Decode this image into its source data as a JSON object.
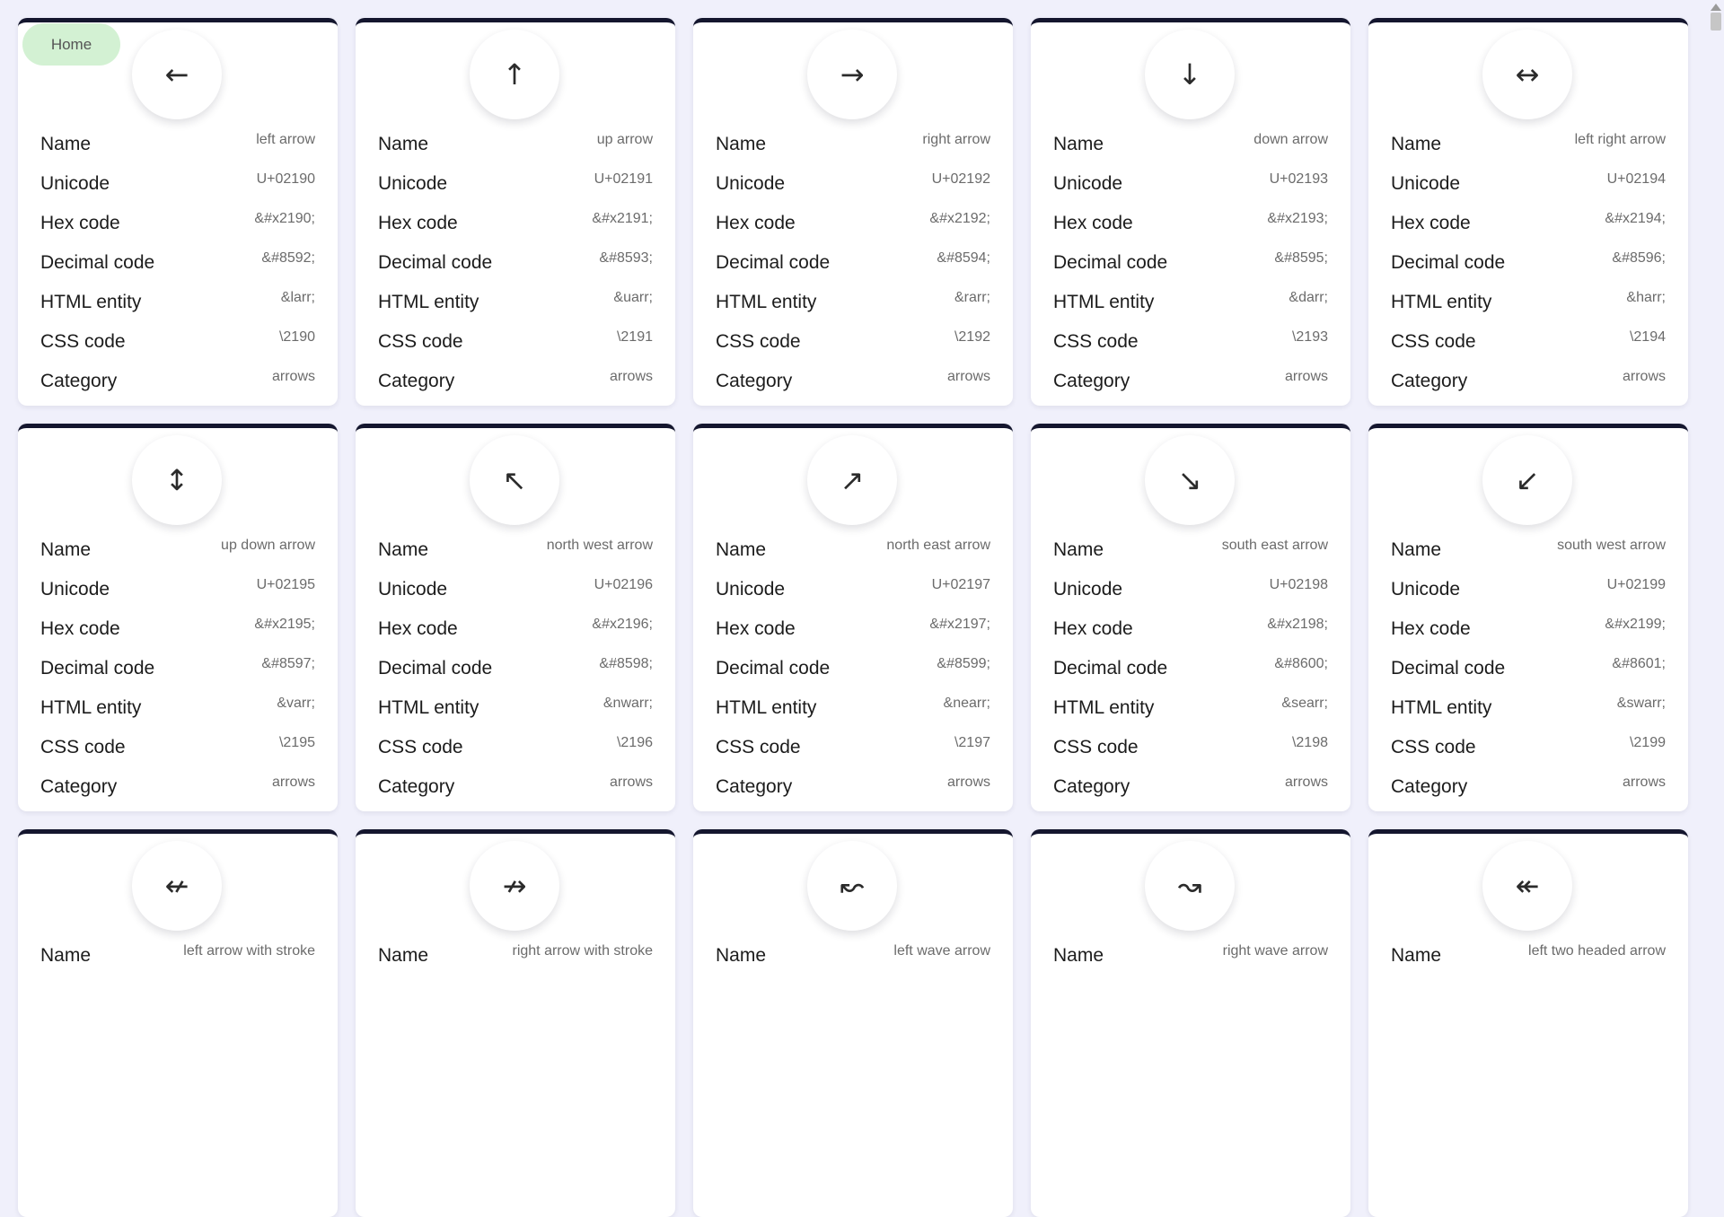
{
  "home_button": {
    "label": "Home"
  },
  "field_labels": {
    "name": "Name",
    "unicode": "Unicode",
    "hex": "Hex code",
    "decimal": "Decimal code",
    "entity": "HTML entity",
    "css": "CSS code",
    "category": "Category"
  },
  "cards": [
    {
      "glyph": "←",
      "icon": "left-arrow-icon",
      "name": "left arrow",
      "unicode": "U+02190",
      "hex": "&#x2190;",
      "decimal": "&#8592;",
      "entity": "&larr;",
      "css": "\\2190",
      "category": "arrows"
    },
    {
      "glyph": "↑",
      "icon": "up-arrow-icon",
      "name": "up arrow",
      "unicode": "U+02191",
      "hex": "&#x2191;",
      "decimal": "&#8593;",
      "entity": "&uarr;",
      "css": "\\2191",
      "category": "arrows"
    },
    {
      "glyph": "→",
      "icon": "right-arrow-icon",
      "name": "right arrow",
      "unicode": "U+02192",
      "hex": "&#x2192;",
      "decimal": "&#8594;",
      "entity": "&rarr;",
      "css": "\\2192",
      "category": "arrows"
    },
    {
      "glyph": "↓",
      "icon": "down-arrow-icon",
      "name": "down arrow",
      "unicode": "U+02193",
      "hex": "&#x2193;",
      "decimal": "&#8595;",
      "entity": "&darr;",
      "css": "\\2193",
      "category": "arrows"
    },
    {
      "glyph": "↔",
      "icon": "left-right-arrow-icon",
      "name": "left right arrow",
      "unicode": "U+02194",
      "hex": "&#x2194;",
      "decimal": "&#8596;",
      "entity": "&harr;",
      "css": "\\2194",
      "category": "arrows"
    },
    {
      "glyph": "↕",
      "icon": "up-down-arrow-icon",
      "name": "up down arrow",
      "unicode": "U+02195",
      "hex": "&#x2195;",
      "decimal": "&#8597;",
      "entity": "&varr;",
      "css": "\\2195",
      "category": "arrows"
    },
    {
      "glyph": "↖",
      "icon": "north-west-arrow-icon",
      "name": "north west arrow",
      "unicode": "U+02196",
      "hex": "&#x2196;",
      "decimal": "&#8598;",
      "entity": "&nwarr;",
      "css": "\\2196",
      "category": "arrows"
    },
    {
      "glyph": "↗",
      "icon": "north-east-arrow-icon",
      "name": "north east arrow",
      "unicode": "U+02197",
      "hex": "&#x2197;",
      "decimal": "&#8599;",
      "entity": "&nearr;",
      "css": "\\2197",
      "category": "arrows"
    },
    {
      "glyph": "↘",
      "icon": "south-east-arrow-icon",
      "name": "south east arrow",
      "unicode": "U+02198",
      "hex": "&#x2198;",
      "decimal": "&#8600;",
      "entity": "&searr;",
      "css": "\\2198",
      "category": "arrows"
    },
    {
      "glyph": "↙",
      "icon": "south-west-arrow-icon",
      "name": "south west arrow",
      "unicode": "U+02199",
      "hex": "&#x2199;",
      "decimal": "&#8601;",
      "entity": "&swarr;",
      "css": "\\2199",
      "category": "arrows"
    },
    {
      "glyph": "↚",
      "icon": "left-arrow-with-stroke-icon",
      "name": "left arrow with stroke"
    },
    {
      "glyph": "↛",
      "icon": "right-arrow-with-stroke-icon",
      "name": "right arrow with stroke"
    },
    {
      "glyph": "↜",
      "icon": "left-wave-arrow-icon",
      "name": "left wave arrow"
    },
    {
      "glyph": "↝",
      "icon": "right-wave-arrow-icon",
      "name": "right wave arrow"
    },
    {
      "glyph": "↞",
      "icon": "left-two-headed-arrow-icon",
      "name": "left two headed arrow"
    }
  ]
}
